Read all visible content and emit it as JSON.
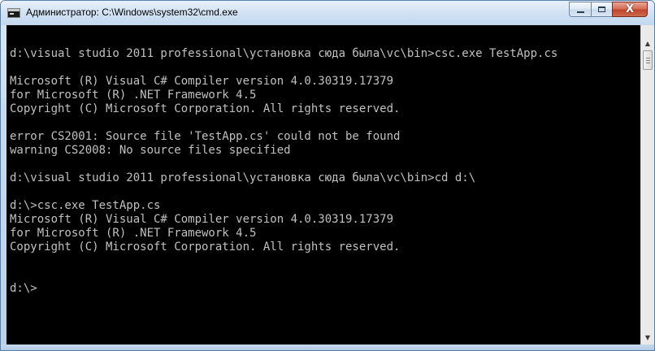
{
  "window": {
    "title": "Администратор: C:\\Windows\\system32\\cmd.exe",
    "icon": "cmd-console-icon",
    "buttons": {
      "minimize_icon": "minimize-icon",
      "maximize_icon": "maximize-icon",
      "close_icon": "close-icon",
      "close_glyph": "X"
    }
  },
  "colors": {
    "console_background": "#000000",
    "console_text": "#c0c0c0",
    "close_button": "#c7442c",
    "title_bar": "#c9dcef"
  },
  "console": {
    "lines": [
      "",
      "d:\\visual studio 2011 professional\\установка сюда была\\vc\\bin>csc.exe TestApp.cs",
      "",
      "Microsoft (R) Visual C# Compiler version 4.0.30319.17379",
      "for Microsoft (R) .NET Framework 4.5",
      "Copyright (C) Microsoft Corporation. All rights reserved.",
      "",
      "error CS2001: Source file 'TestApp.cs' could not be found",
      "warning CS2008: No source files specified",
      "",
      "d:\\visual studio 2011 professional\\установка сюда была\\vc\\bin>cd d:\\",
      "",
      "d:\\>csc.exe TestApp.cs",
      "Microsoft (R) Visual C# Compiler version 4.0.30319.17379",
      "for Microsoft (R) .NET Framework 4.5",
      "Copyright (C) Microsoft Corporation. All rights reserved.",
      "",
      "",
      "d:\\>"
    ]
  },
  "scrollbar": {
    "up_arrow": "▲",
    "down_arrow": "▼"
  }
}
